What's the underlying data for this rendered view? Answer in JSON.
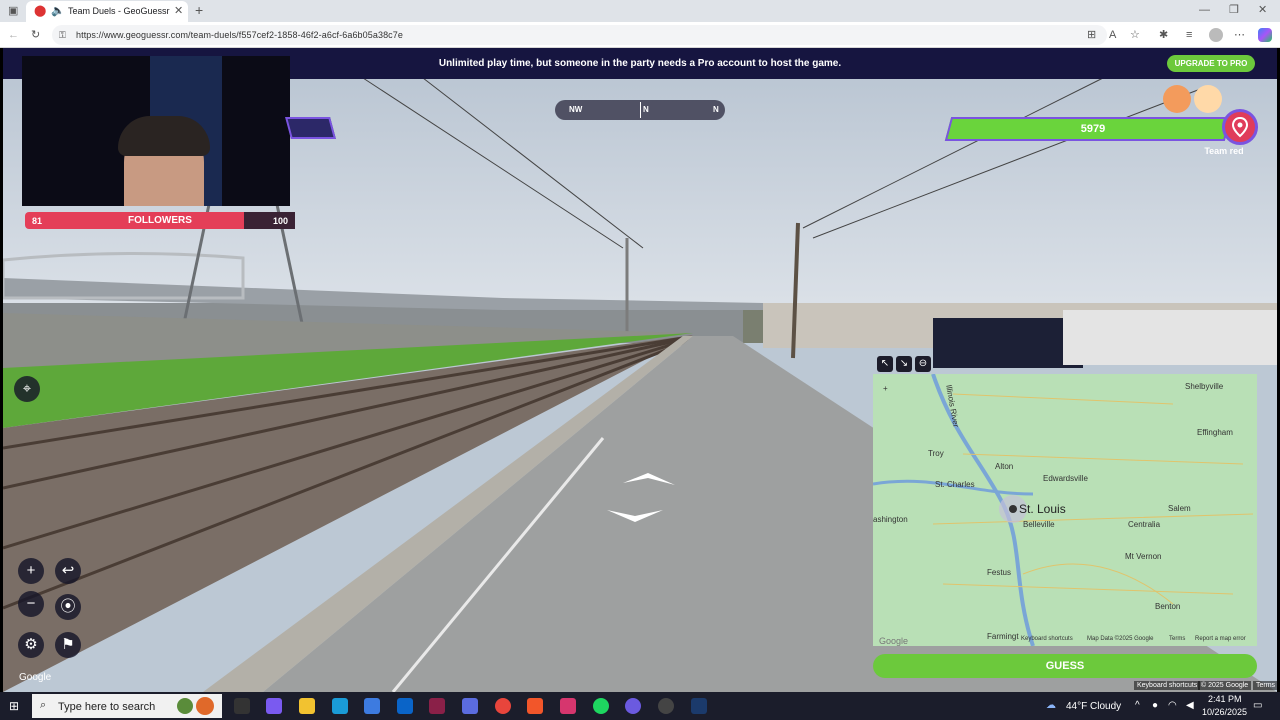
{
  "browser": {
    "tab_title": "Team Duels - GeoGuessr",
    "url": "https://www.geoguessr.com/team-duels/f557cef2-1858-46f2-a6cf-6a6b05a38c7e"
  },
  "banner": {
    "message": "Unlimited play time, but someone in the party needs a Pro account to host the game.",
    "upgrade_label": "UPGRADE TO PRO"
  },
  "stream_overlay": {
    "followers_label": "FOLLOWERS",
    "followers_current": "81",
    "followers_goal": "100",
    "progress_fraction": 0.81
  },
  "compass": {
    "left": "NW",
    "center": "N",
    "right": "N"
  },
  "team": {
    "health": "5979",
    "name": "Team red",
    "color": "#e03c5a",
    "bar_color": "#6ad43c"
  },
  "map": {
    "main_city": "St. Louis",
    "labels": [
      "Troy",
      "Alton",
      "Edwardsville",
      "St. Charles",
      "ashington",
      "Belleville",
      "Festus",
      "Salem",
      "Centralia",
      "Mt Vernon",
      "Benton",
      "Effingham",
      "Shelbyville",
      "Farmingt",
      "Illinois River"
    ],
    "footer": {
      "logo": "Google",
      "shortcuts": "Keyboard shortcuts",
      "data": "Map Data ©2025 Google",
      "terms": "Terms",
      "report": "Report a map error"
    },
    "guess_label": "GUESS"
  },
  "streetview": {
    "logo": "Google",
    "attrib_shortcuts": "Keyboard shortcuts",
    "attrib_data": "© 2025 Google",
    "attrib_terms": "Terms"
  },
  "taskbar": {
    "search_placeholder": "Type here to search",
    "weather": "44°F  Cloudy",
    "time": "2:41 PM",
    "date": "10/26/2025"
  }
}
